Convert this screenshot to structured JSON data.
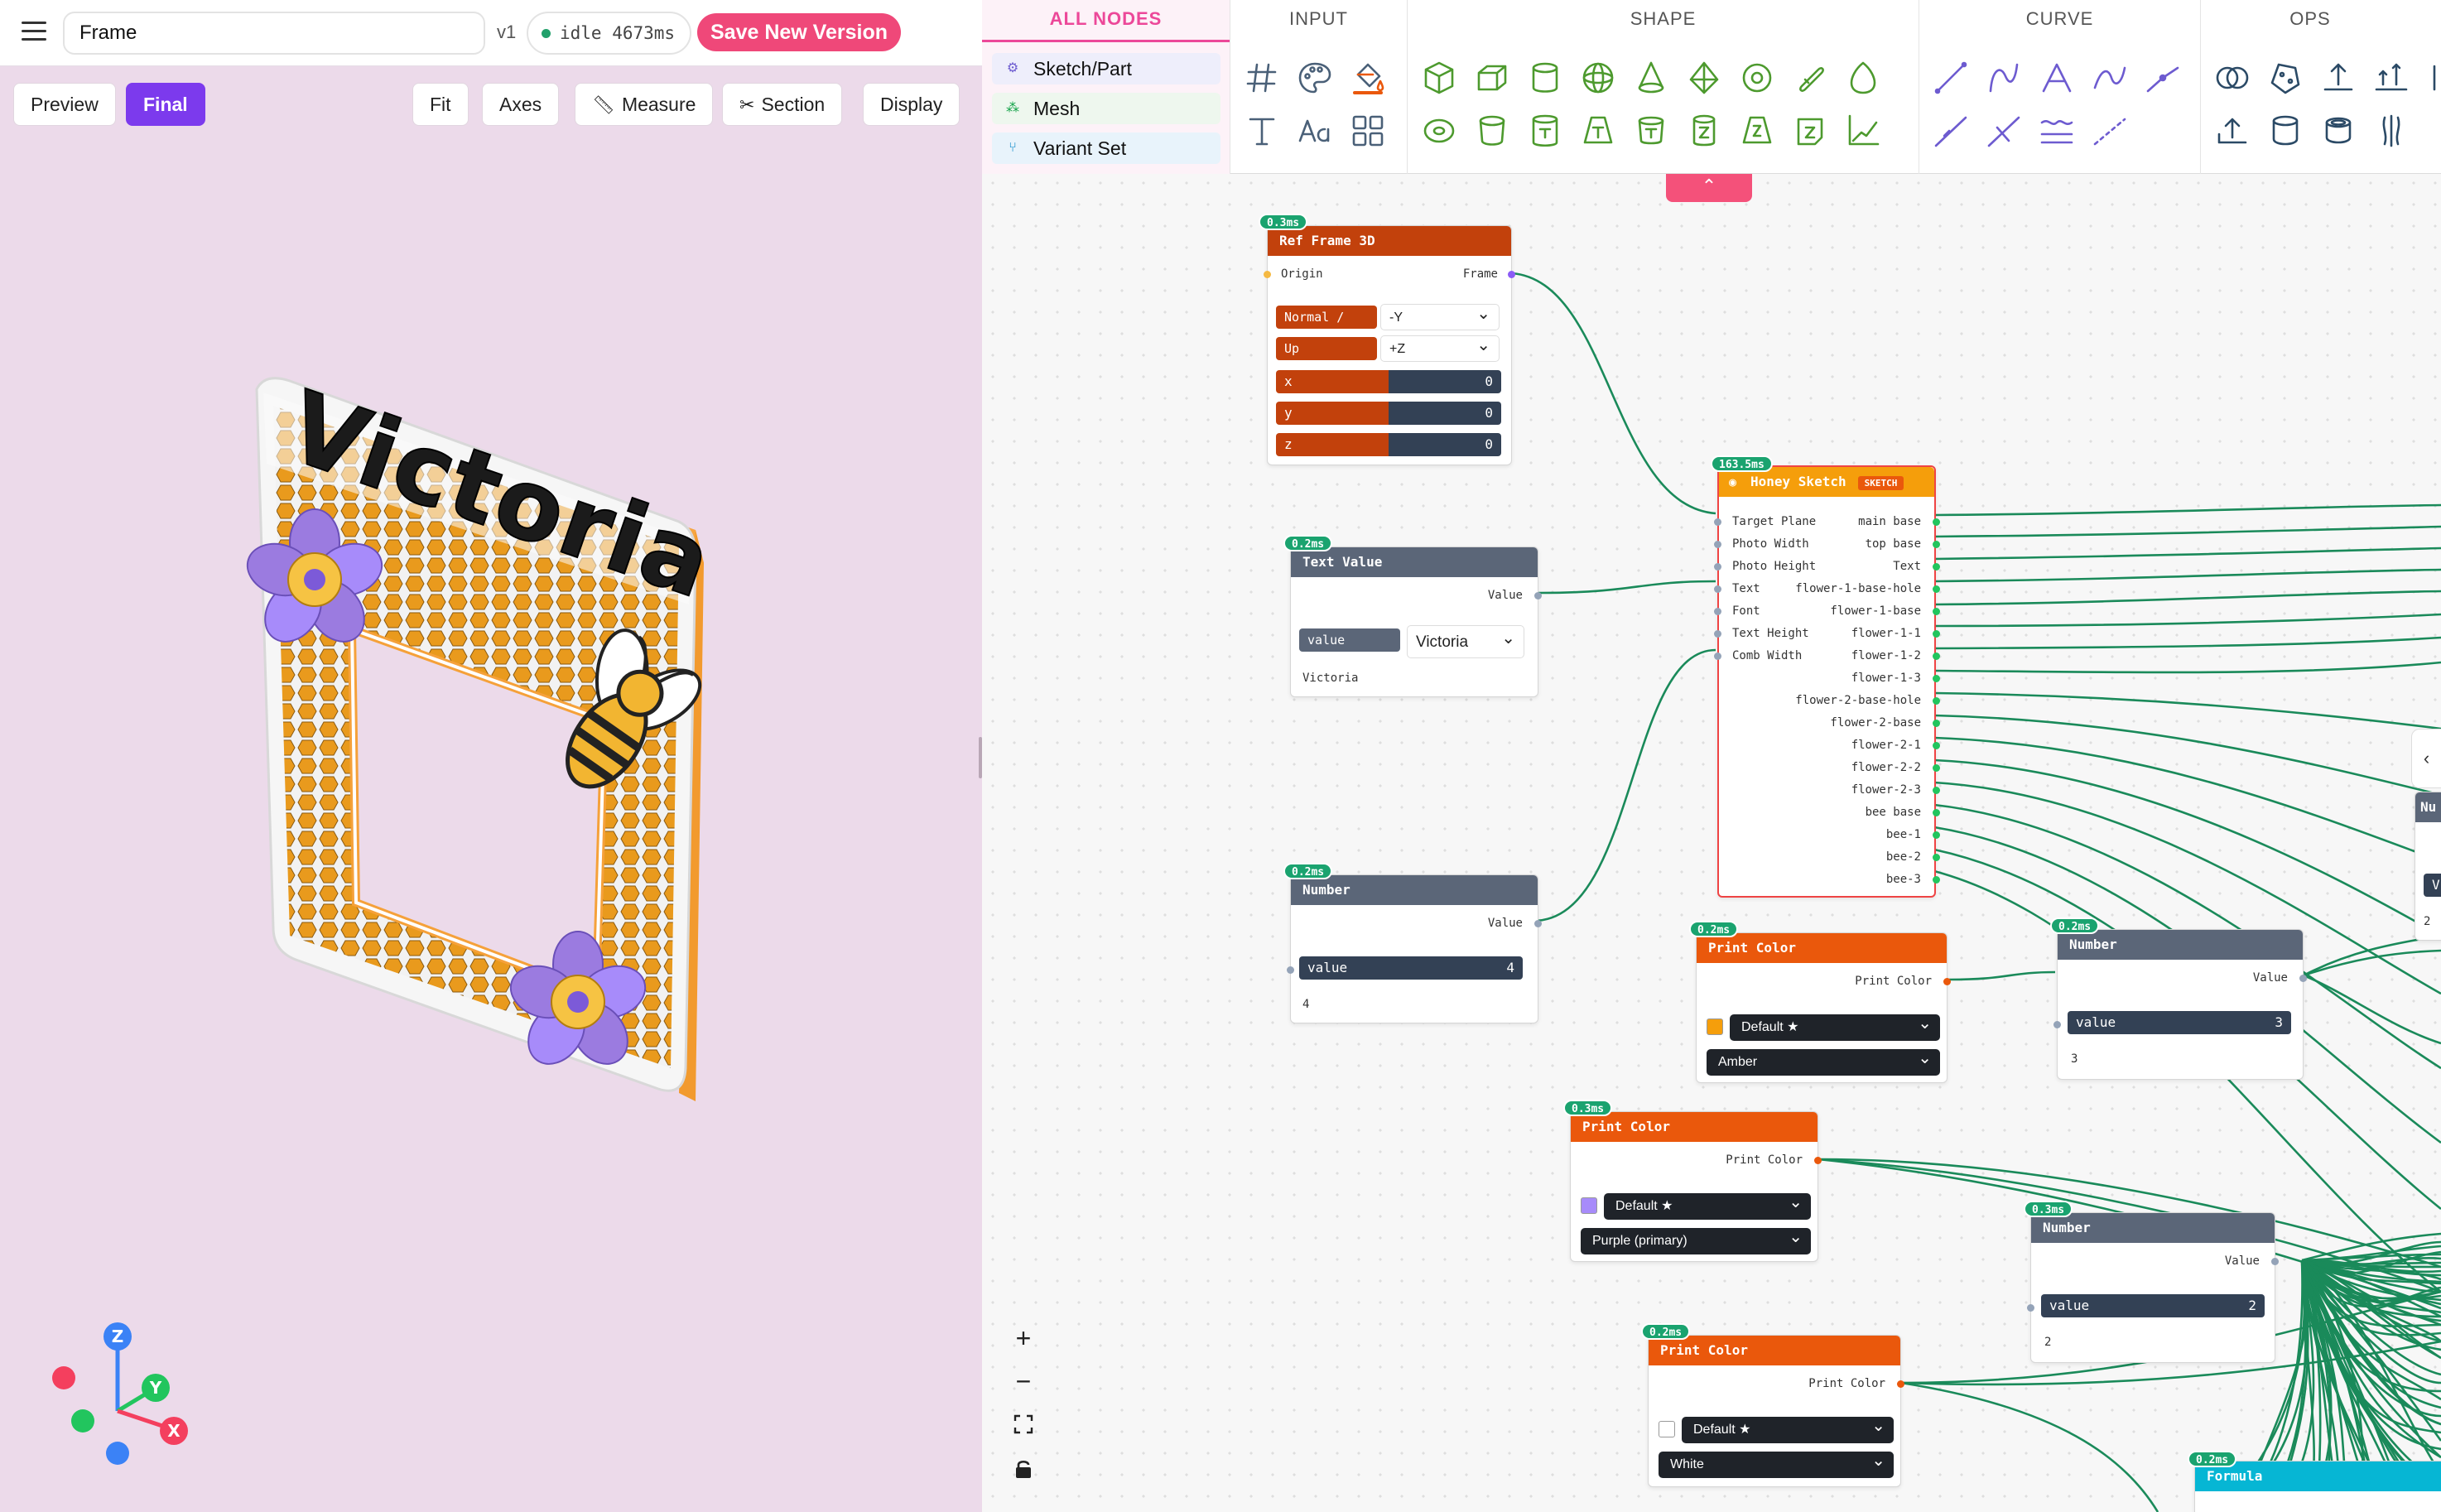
{
  "header": {
    "menu_icon": "hamburger-menu-icon",
    "title": "Frame",
    "version": "v1",
    "status": "idle 4673ms",
    "save_label": "Save New Version"
  },
  "viewport": {
    "buttons": [
      {
        "label": "Preview",
        "active": false
      },
      {
        "label": "Final",
        "active": true
      },
      {
        "label": "Fit",
        "active": false
      },
      {
        "label": "Axes",
        "active": false
      },
      {
        "label": "Measure",
        "active": false,
        "icon": "ruler-icon"
      },
      {
        "label": "Section",
        "active": false,
        "icon": "scissors-icon"
      },
      {
        "label": "Display",
        "active": false
      }
    ],
    "model_text": "Victoria",
    "triad": {
      "z": "Z",
      "y": "Y",
      "x": "X"
    }
  },
  "toolbar": {
    "categories": [
      {
        "label": "ALL NODES",
        "active": true
      },
      {
        "label": "INPUT"
      },
      {
        "label": "SHAPE"
      },
      {
        "label": "CURVE"
      },
      {
        "label": "OPS"
      }
    ],
    "chips": [
      {
        "label": "Sketch/Part",
        "icon": "sketch-part-icon",
        "color": "#6d5bd0",
        "bg": "#eeeefb"
      },
      {
        "label": "Mesh",
        "icon": "mesh-icon",
        "color": "#16a34a",
        "bg": "#eef7ee"
      },
      {
        "label": "Variant Set",
        "icon": "variant-set-icon",
        "color": "#0284c7",
        "bg": "#e8f3fb"
      }
    ],
    "collapse_icon": "chevron-up-icon"
  },
  "canvas_controls": {
    "zoom_in": "+",
    "zoom_out": "−",
    "fit_icon": "fit-view-icon",
    "lock_icon": "lock-icon",
    "side_tab": "‹"
  },
  "nodes": {
    "ref_frame": {
      "timing": "0.3ms",
      "title": "Ref Frame 3D",
      "in_origin": "Origin",
      "out_frame": "Frame",
      "normal_label": "Normal / Axis",
      "normal_value": "-Y",
      "up_label": "Up",
      "up_value": "+Z",
      "x_label": "x",
      "x_value": "0",
      "y_label": "y",
      "y_value": "0",
      "z_label": "z",
      "z_value": "0"
    },
    "text_value": {
      "timing": "0.2ms",
      "title": "Text Value",
      "out_value": "Value",
      "field_label": "value",
      "field_value": "Victoria",
      "preview": "Victoria"
    },
    "number_a": {
      "timing": "0.2ms",
      "title": "Number",
      "out_value": "Value",
      "field_label": "value",
      "field_value": "4",
      "preview": "4"
    },
    "honey_sketch": {
      "timing": "163.5ms",
      "title": "Honey Sketch",
      "tag": "SKETCH",
      "inputs": [
        "Target Plane",
        "Photo Width",
        "Photo Height",
        "Text",
        "Font",
        "Text Height",
        "Comb Width"
      ],
      "outputs": [
        "main base",
        "top base",
        "Text",
        "flower-1-base-hole",
        "flower-1-base",
        "flower-1-1",
        "flower-1-2",
        "flower-1-3",
        "flower-2-base-hole",
        "flower-2-base",
        "flower-2-1",
        "flower-2-2",
        "flower-2-3",
        "bee base",
        "bee-1",
        "bee-2",
        "bee-3"
      ]
    },
    "print_color_amber": {
      "timing": "0.2ms",
      "title": "Print Color",
      "out_label": "Print Color",
      "swatch": "#f59e0b",
      "mode": "Default ★",
      "color_name": "Amber"
    },
    "print_color_purple": {
      "timing": "0.3ms",
      "title": "Print Color",
      "out_label": "Print Color",
      "swatch": "#a78bfa",
      "mode": "Default ★",
      "color_name": "Purple (primary)"
    },
    "print_color_white": {
      "timing": "0.2ms",
      "title": "Print Color",
      "out_label": "Print Color",
      "swatch": "#ffffff",
      "mode": "Default ★",
      "color_name": "White"
    },
    "number_b": {
      "timing": "0.2ms",
      "title": "Number",
      "out_value": "Value",
      "field_label": "value",
      "field_value": "3",
      "preview": "3"
    },
    "number_c": {
      "timing": "0.3ms",
      "title": "Number",
      "out_value": "Value",
      "field_label": "value",
      "field_value": "2",
      "preview": "2"
    },
    "formula": {
      "timing": "0.2ms",
      "title": "Formula"
    },
    "partial_right": {
      "title_fragment": "Nu",
      "value_fragment": "V",
      "preview_fragment": "2"
    }
  },
  "colors": {
    "accent_pink": "#ef4879",
    "final_purple": "#7c3aed",
    "ref_frame_header": "#c2410c",
    "print_color_header": "#ea580c",
    "number_header": "#5b6678",
    "honey_header": "#f59e0b",
    "formula_header": "#06b6d4",
    "wire": "#1a8a5a"
  }
}
